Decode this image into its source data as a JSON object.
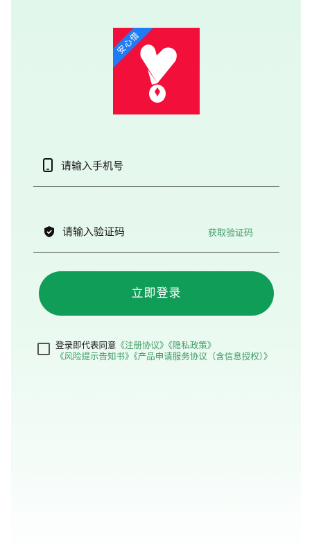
{
  "logo": {
    "ribbon_text": "安心借"
  },
  "phone_input": {
    "placeholder": "请输入手机号",
    "icon": "phone-icon"
  },
  "code_input": {
    "placeholder": "请输入验证码",
    "icon": "shield-icon",
    "get_code_label": "获取验证码"
  },
  "login_button": {
    "label": "立即登录"
  },
  "agreement": {
    "prefix": "登录即代表同意",
    "links": [
      "《注册协议》",
      "《隐私政策》",
      "《风险提示告知书》",
      "《产品申请服务协议（含信息授权）》"
    ]
  },
  "colors": {
    "brand_green": "#0f9d58",
    "link_green": "#3e9a64",
    "logo_red": "#f20f3a",
    "ribbon_blue": "#1f7cf4",
    "background": "#e2f7ec"
  }
}
